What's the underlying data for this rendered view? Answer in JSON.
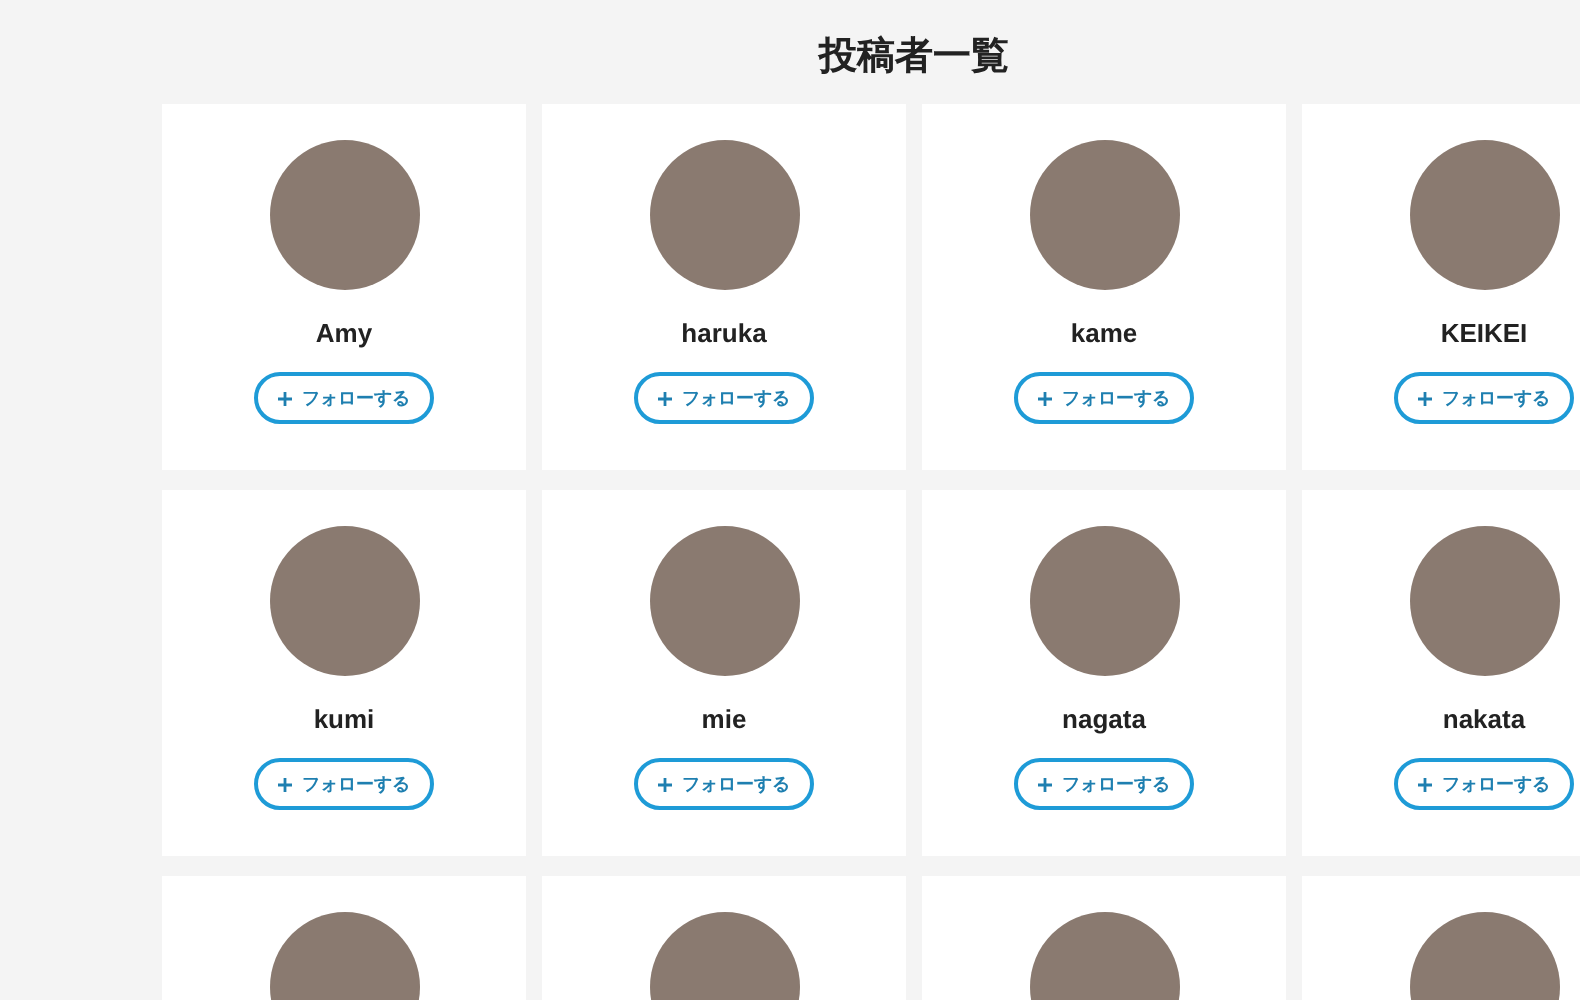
{
  "title": "投稿者一覧",
  "users": [
    {
      "kind": "full",
      "name": "Amy",
      "button": "フォローする"
    },
    {
      "kind": "full",
      "name": "haruka",
      "button": "フォローする"
    },
    {
      "kind": "full",
      "name": "kame",
      "button": "フォローする"
    },
    {
      "kind": "full",
      "name": "KEIKEI",
      "button": "フォローする"
    },
    {
      "kind": "full",
      "name": "kumi",
      "button": "フォローする"
    },
    {
      "kind": "full",
      "name": "mie",
      "button": "フォローする"
    },
    {
      "kind": "full",
      "name": "nagata",
      "button": "フォローする"
    },
    {
      "kind": "full",
      "name": "nakata",
      "button": "フォローする"
    },
    {
      "kind": "cut"
    },
    {
      "kind": "cut"
    },
    {
      "kind": "cut"
    },
    {
      "kind": "cut"
    }
  ]
}
